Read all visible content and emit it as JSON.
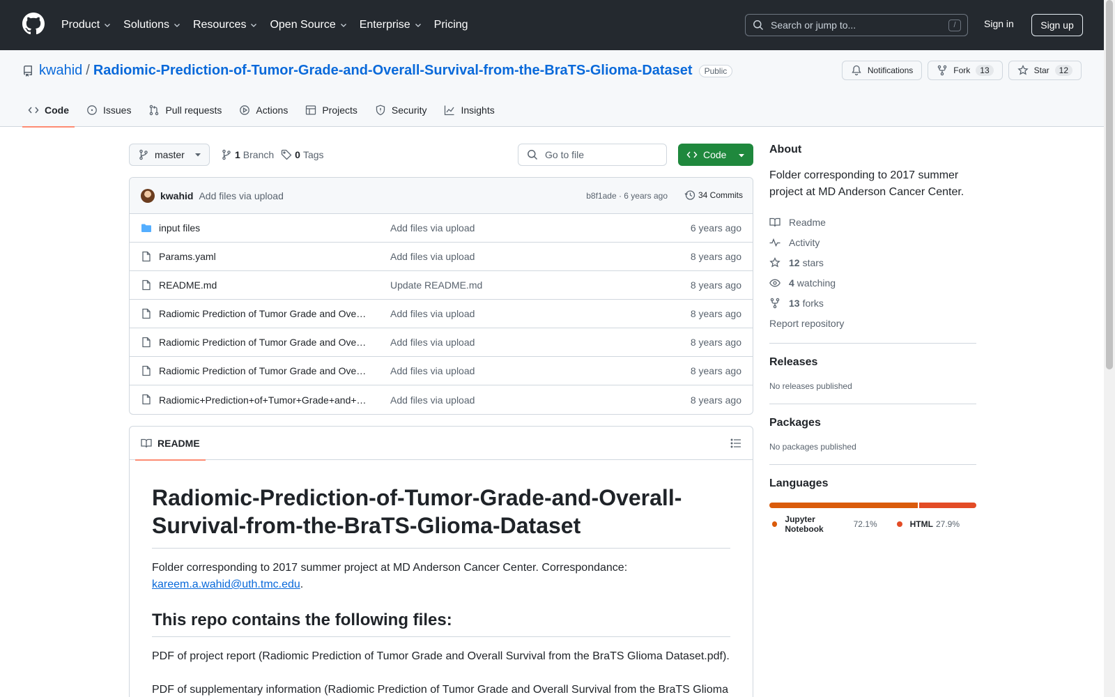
{
  "header": {
    "nav": [
      {
        "label": "Product",
        "dropdown": true
      },
      {
        "label": "Solutions",
        "dropdown": true
      },
      {
        "label": "Resources",
        "dropdown": true
      },
      {
        "label": "Open Source",
        "dropdown": true
      },
      {
        "label": "Enterprise",
        "dropdown": true
      },
      {
        "label": "Pricing",
        "dropdown": false
      }
    ],
    "search_placeholder": "Search or jump to...",
    "search_shortcut": "/",
    "sign_in": "Sign in",
    "sign_up": "Sign up"
  },
  "repo": {
    "owner": "kwahid",
    "separator": "/",
    "name": "Radiomic-Prediction-of-Tumor-Grade-and-Overall-Survival-from-the-BraTS-Glioma-Dataset",
    "visibility": "Public",
    "notifications_label": "Notifications",
    "fork_label": "Fork",
    "fork_count": "13",
    "star_label": "Star",
    "star_count": "12"
  },
  "tabs": [
    {
      "label": "Code",
      "icon": "code-icon",
      "active": true
    },
    {
      "label": "Issues",
      "icon": "issue-icon",
      "active": false
    },
    {
      "label": "Pull requests",
      "icon": "pull-request-icon",
      "active": false
    },
    {
      "label": "Actions",
      "icon": "play-icon",
      "active": false
    },
    {
      "label": "Projects",
      "icon": "table-icon",
      "active": false
    },
    {
      "label": "Security",
      "icon": "shield-icon",
      "active": false
    },
    {
      "label": "Insights",
      "icon": "graph-icon",
      "active": false
    }
  ],
  "toolbar": {
    "branch": "master",
    "branch_count": "1",
    "branch_label": "Branch",
    "tag_count": "0",
    "tag_label": "Tags",
    "goto_placeholder": "Go to file",
    "code_label": "Code"
  },
  "commit": {
    "author": "kwahid",
    "message": "Add files via upload",
    "meta": "b8f1ade · 6 years ago",
    "commits_label": "34 Commits"
  },
  "files": [
    {
      "type": "folder",
      "name": "input files",
      "commit": "Add files via upload",
      "age": "6 years ago"
    },
    {
      "type": "file",
      "name": "Params.yaml",
      "commit": "Add files via upload",
      "age": "8 years ago"
    },
    {
      "type": "file",
      "name": "README.md",
      "commit": "Update README.md",
      "age": "8 years ago"
    },
    {
      "type": "file",
      "name": "Radiomic Prediction of Tumor Grade and Overall Survival from the BraTS Glioma Dataset.pdf",
      "commit": "Add files via upload",
      "age": "8 years ago"
    },
    {
      "type": "file",
      "name": "Radiomic Prediction of Tumor Grade and Overall Survival from the BraTS Glioma Dataset - Supplementary.pdf",
      "commit": "Add files via upload",
      "age": "8 years ago"
    },
    {
      "type": "file",
      "name": "Radiomic Prediction of Tumor Grade and Overall Survival from the BraTS Glioma Dataset.ipynb",
      "commit": "Add files via upload",
      "age": "8 years ago"
    },
    {
      "type": "file",
      "name": "Radiomic+Prediction+of+Tumor+Grade+and+Overall+Survival.html",
      "commit": "Add files via upload",
      "age": "8 years ago"
    }
  ],
  "readme": {
    "tab_label": "README",
    "title": "Radiomic-Prediction-of-Tumor-Grade-and-Overall-Survival-from-the-BraTS-Glioma-Dataset",
    "intro": "Folder corresponding to 2017 summer project at MD Anderson Cancer Center. Correspondance: ",
    "email": "kareem.a.wahid@uth.tmc.edu",
    "intro_end": ".",
    "section_title": "This repo contains the following files:",
    "para1": "PDF of project report (Radiomic Prediction of Tumor Grade and Overall Survival from the BraTS Glioma Dataset.pdf).",
    "para2": "PDF of supplementary information (Radiomic Prediction of Tumor Grade and Overall Survival from the BraTS Glioma"
  },
  "sidebar": {
    "about_title": "About",
    "about_desc": "Folder corresponding to 2017 summer project at MD Anderson Cancer Center.",
    "links": [
      {
        "icon": "book-icon",
        "count": "",
        "label": "Readme"
      },
      {
        "icon": "pulse-icon",
        "count": "",
        "label": "Activity"
      },
      {
        "icon": "star-icon",
        "count": "12",
        "label": "stars"
      },
      {
        "icon": "eye-icon",
        "count": "4",
        "label": "watching"
      },
      {
        "icon": "fork-icon",
        "count": "13",
        "label": "forks"
      }
    ],
    "report": "Report repository",
    "releases_title": "Releases",
    "releases_note": "No releases published",
    "packages_title": "Packages",
    "packages_note": "No packages published",
    "languages_title": "Languages",
    "languages": [
      {
        "name": "Jupyter Notebook",
        "percent": "72.1%",
        "value": 72.1,
        "color": "#DA5B0B"
      },
      {
        "name": "HTML",
        "percent": "27.9%",
        "value": 27.9,
        "color": "#E34C26"
      }
    ]
  }
}
